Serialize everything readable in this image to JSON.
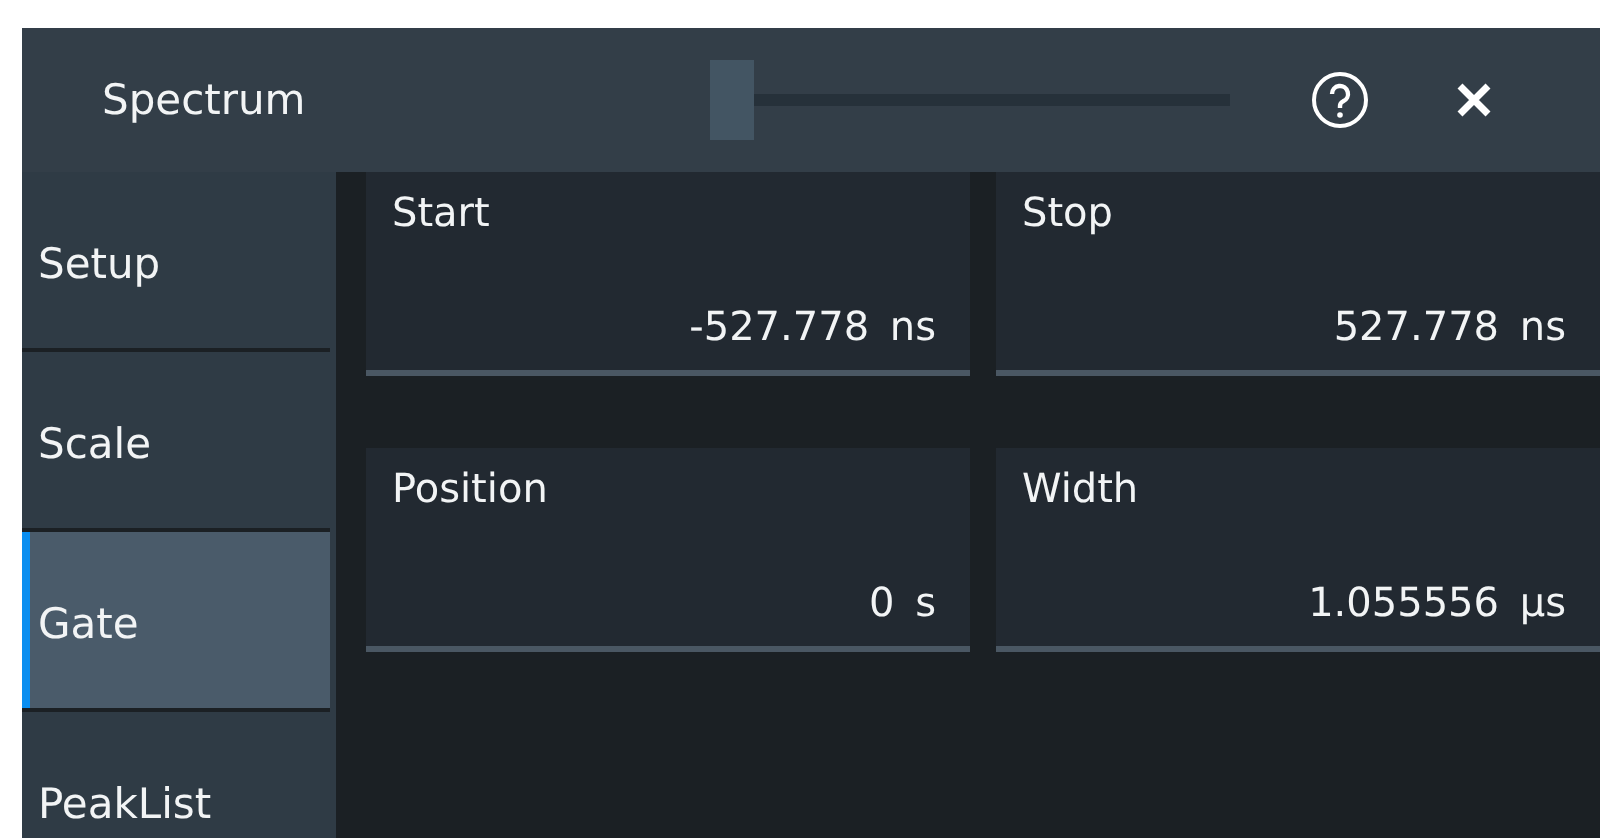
{
  "window": {
    "title": "Spectrum",
    "slider": {
      "level": 0
    }
  },
  "sidebar": {
    "items": [
      {
        "label": "Setup",
        "selected": false
      },
      {
        "label": "Scale",
        "selected": false
      },
      {
        "label": "Gate",
        "selected": true
      },
      {
        "label": "PeakList",
        "selected": false
      }
    ]
  },
  "fields": [
    {
      "label": "Start",
      "value": "-527.778 ns"
    },
    {
      "label": "Stop",
      "value": "527.778 ns"
    },
    {
      "label": "Position",
      "value": "0 s"
    },
    {
      "label": "Width",
      "value": "1.055556 µs"
    }
  ]
}
